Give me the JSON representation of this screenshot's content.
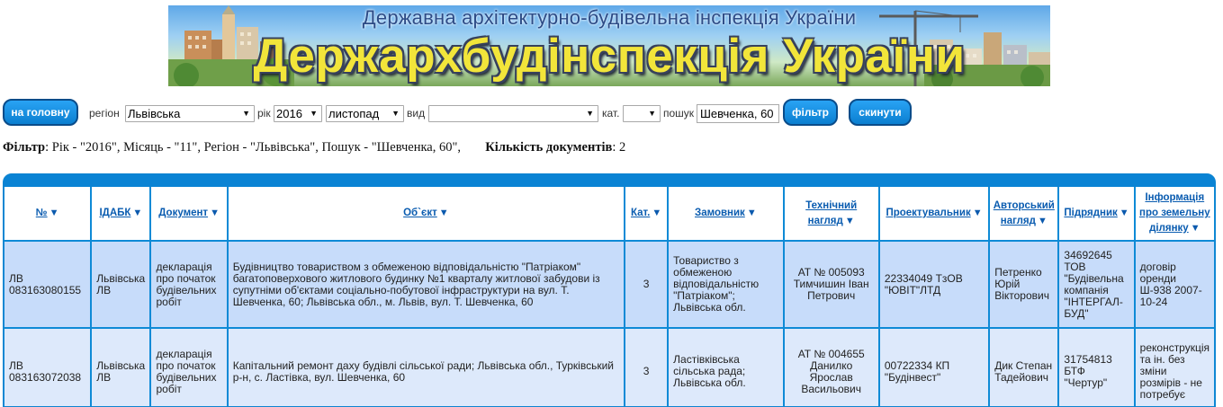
{
  "banner": {
    "subtitle": "Державна архітектурно-будівельна інспекція України",
    "title": "Держархбудінспекція України"
  },
  "toolbar": {
    "home_label": "на головну",
    "region_label": "регіон",
    "region_value": "Львівська",
    "year_label": "рік",
    "year_value": "2016",
    "month_value": "листопад",
    "type_label": "вид",
    "type_value": "",
    "cat_label": "кат.",
    "cat_value": "",
    "search_label": "пошук",
    "search_value": "Шевченка, 60",
    "filter_label": "фільтр",
    "reset_label": "скинути"
  },
  "filter_summary": {
    "filter_label": "Фільтр",
    "filter_text": ": Рік - \"2016\", Місяць - \"11\", Регіон - \"Львівська\", Пошук - \"Шевченка, 60\",",
    "count_label": "Кількість документів",
    "count_text": ": 2"
  },
  "table": {
    "headers": [
      "№",
      "ІДАБК",
      "Документ",
      "Об`єкт",
      "Кат.",
      "Замовник",
      "Технічний нагляд",
      "Проектувальник",
      "Авторський нагляд",
      "Підрядник",
      "Інформація про земельну ділянку"
    ],
    "rows": [
      {
        "num": "ЛВ 083163080155",
        "idabk": "Львівська ЛВ",
        "doc": "декларація про початок будівельних робіт",
        "object": "Будівництво товариством з обмеженою відповідальністю \"Патріаком\" багатоповерхового житлового будинку №1 кварталу житлової забудови із супутніми об'єктами соціально-побутової інфраструктури на вул. Т. Шевченка, 60; Львівська обл., м. Львів, вул. Т. Шевченка, 60",
        "cat": "3",
        "customer": "Товариство з обмеженою відповідальністю \"Патріаком\"; Львівська обл.",
        "tech": "АТ № 005093 Тимчишин Іван Петрович",
        "designer": "22334049 ТзОВ \"ЮВІТ\"ЛТД",
        "author": "Петренко Юрій Вікторович",
        "contractor": "34692645 ТОВ \"Будівельна компанія \"ІНТЕРГАЛ-БУД\"",
        "land": "договір оренди Ш-938 2007-10-24"
      },
      {
        "num": "ЛВ 083163072038",
        "idabk": "Львівська ЛВ",
        "doc": "декларація про початок будівельних робіт",
        "object": "Капітальний ремонт даху будівлі сільської ради; Львівська обл., Турківський р-н, с. Ластівка, вул. Шевченка, 60",
        "cat": "3",
        "customer": "Ластівківська сільська рада; Львівська обл.",
        "tech": "АТ № 004655 Данилко Ярослав Васильович",
        "designer": "00722334 КП \"Будінвест\"",
        "author": "Дик Степан Тадейович",
        "contractor": "31754813 БТФ \"Чертур\"",
        "land": "реконструкція та ін. без зміни розмірів - не потребує"
      }
    ]
  },
  "colors": {
    "button_fill": "#0b7fd0",
    "header_bar": "#0a83d4",
    "row_fill_1": "#c7dcfa",
    "row_fill_2": "#dde9fb",
    "header_text": "#0a5cb0",
    "banner_title": "#f2e53a"
  },
  "icons": {
    "sort_indicator": "sort-down-icon",
    "select_arrow": "chevron-down-icon"
  }
}
